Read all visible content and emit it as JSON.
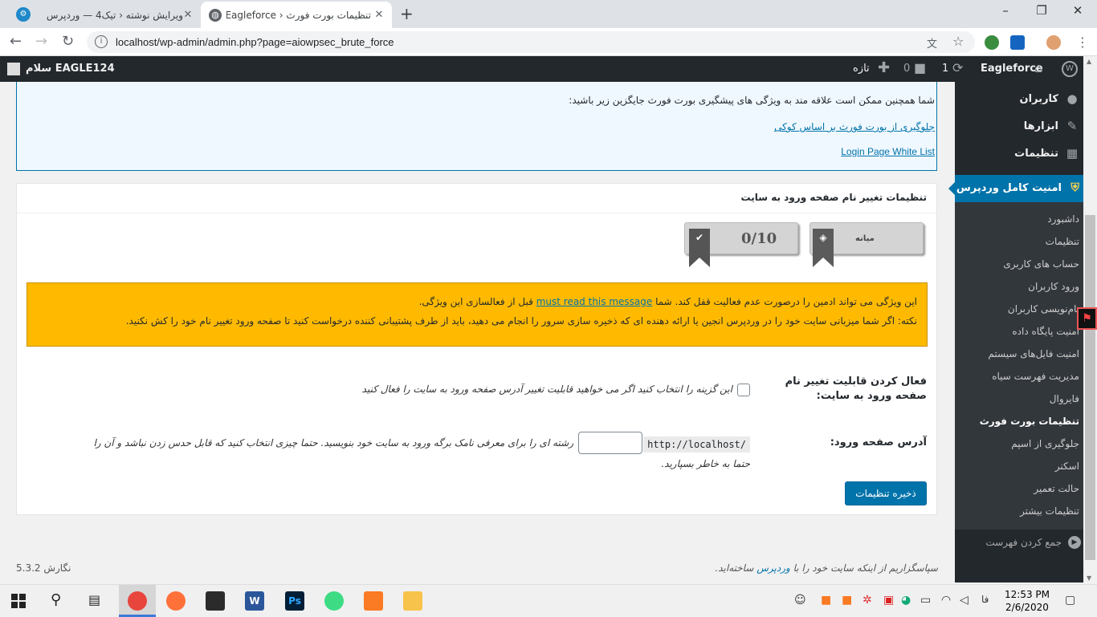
{
  "browser": {
    "tabs": [
      {
        "title": "ویرایش نوشته ‹ تیک4 — وردپرس",
        "active": false
      },
      {
        "title": "تنظیمات بورت فورث ‹ Eagleforce ‹",
        "active": true
      }
    ],
    "url": "localhost/wp-admin/admin.php?page=aiowpsec_brute_force"
  },
  "adminbar": {
    "greeting": "سلام EAGLE124",
    "site_name": "Eagleforce",
    "updates_count": "1",
    "comments_count": "0",
    "new_label": "تازه"
  },
  "sidebar": {
    "top_items": [
      {
        "label": "کاربران",
        "icon": "users-icon"
      },
      {
        "label": "ابزارها",
        "icon": "wrench-icon"
      },
      {
        "label": "تنظیمات",
        "icon": "settings-icon"
      }
    ],
    "active_menu": "امنیت کامل وردپرس",
    "submenu": [
      "داشبورد",
      "تنظیمات",
      "حساب های کاربری",
      "ورود کاربران",
      "نام‌نویسی کاربران",
      "امنیت پایگاه داده",
      "امنیت فایل‌های سیستم",
      "مدیریت فهرست سیاه",
      "فایروال",
      "تنظیمات بورت فورث",
      "جلوگیری از اسپم",
      "اسکنر",
      "حالت تعمیر",
      "تنظیمات بیشتر"
    ],
    "current_sub_index": 9,
    "collapse_label": "جمع کردن فهرست"
  },
  "notice": {
    "intro": "شما همچنین ممکن است علاقه مند به ویژگی های پیشگیری بورت فورث جایگزین زیر باشید:",
    "link1": "جلوگیری از بورت فورث بر اساس کوکی",
    "link2": "Login Page White List"
  },
  "postbox": {
    "title": "تنظیمات تغییر نام صفحه ورود به سایت",
    "badge_level": "میانه",
    "badge_score": "0/10",
    "warning_line1_a": "این ویژگی می تواند ادمین را درصورت عدم فعالیت قفل کند. شما",
    "warning_link": "must read this message",
    "warning_line1_b": "قبل از فعالسازی این ویژگی.",
    "warning_line2": "نکته: اگر شما میزبانی سایت خود را در وردپرس انجین یا ارائه دهنده ای که ذخیره سازی سرور را انجام می دهید، باید از طرف پشتیبانی کننده درخواست کنید تا صفحه ورود تغییر نام خود را کش نکنید.",
    "enable_label": "فعال کردن قابلیت تغییر نام صفحه ورود به سایت:",
    "enable_desc": "این گزینه را انتخاب کنید اگر می خواهید قابلیت تغییر آدرس صفحه ورود به سایت را فعال کنید",
    "enable_checked": false,
    "login_url_label": "آدرس صفحه ورود:",
    "url_prefix": "http://localhost/",
    "slug_value": "",
    "login_url_desc_1": "رشته ای را برای معرفی نامک برگه ورود به سایت خود بنویسید. حتما چیزی انتخاب کنید که قابل حدس زدن نباشد و آن را",
    "login_url_desc_2": "حتما به خاطر بسپارید.",
    "save_label": "ذخیره تنظیمات"
  },
  "footer": {
    "thanks_pre": "سپاسگزاریم از اینکه سایت خود را با",
    "thanks_link": "وردپرس",
    "thanks_post": "ساخته‌اید.",
    "version": "نگارش 5.3.2"
  },
  "taskbar": {
    "apps": [
      {
        "name": "chrome",
        "label": "",
        "color": "#e8453c"
      },
      {
        "name": "firefox",
        "label": "",
        "color": "#ff7139"
      },
      {
        "name": "notepad",
        "label": "",
        "color": "#2b2b2b"
      },
      {
        "name": "word",
        "label": "W",
        "color": "#2b579a"
      },
      {
        "name": "photoshop",
        "label": "Ps",
        "color": "#001e36"
      },
      {
        "name": "android-studio",
        "label": "",
        "color": "#3ddc84"
      },
      {
        "name": "xampp",
        "label": "",
        "color": "#fb7a24"
      },
      {
        "name": "file-explorer",
        "label": "",
        "color": "#f8c34a"
      }
    ],
    "lang": "فا",
    "time": "12:53 PM",
    "date": "2/6/2020"
  }
}
